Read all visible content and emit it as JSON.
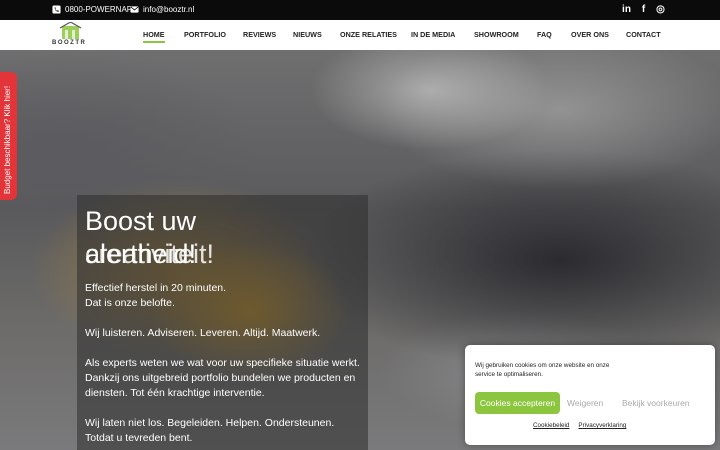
{
  "topbar": {
    "phone": "0800-POWERNAP",
    "email": "info@booztr.nl",
    "social": [
      {
        "icon": "linkedin-icon",
        "glyph": "in"
      },
      {
        "icon": "facebook-icon",
        "glyph": "f"
      },
      {
        "icon": "instagram-icon",
        "glyph": "◎"
      }
    ]
  },
  "logo": {
    "text": "BOOZTR"
  },
  "nav": {
    "items": [
      {
        "label": "HOME",
        "active": true
      },
      {
        "label": "PORTFOLIO"
      },
      {
        "label": "REVIEWS"
      },
      {
        "label": "NIEUWS"
      },
      {
        "label": "ONZE RELATIES"
      },
      {
        "label": "IN DE MEDIA"
      },
      {
        "label": "SHOWROOM"
      },
      {
        "label": "FAQ"
      },
      {
        "label": "OVER ONS"
      },
      {
        "label": "CONTACT"
      }
    ]
  },
  "side_tab": {
    "label": "Budget beschikbaar? Klik hier!"
  },
  "hero": {
    "title_line1": "Boost uw",
    "title_line2_a": "alertheid!",
    "title_line2_b": "creativiteit!",
    "p1_line1": "Effectief herstel in 20 minuten.",
    "p1_line2": "Dat is onze belofte.",
    "p2": "Wij luisteren. Adviseren. Leveren. Altijd. Maatwerk.",
    "p3_line1": "Als experts weten we wat voor uw specifieke situatie werkt.",
    "p3_line2": "Dankzij ons uitgebreid portfolio bundelen we producten en",
    "p3_line3": "diensten. Tot één krachtige interventie.",
    "p4_line1": "Wij laten niet los. Begeleiden. Helpen. Ondersteunen.",
    "p4_line2": "Totdat u tevreden bent."
  },
  "cookie": {
    "message": "Wij gebruiken cookies om onze website en onze service te optimaliseren.",
    "accept_label": "Cookies accepteren",
    "deny_label": "Weigeren",
    "prefs_label": "Bekijk voorkeuren",
    "policy_link": "Cookiebeleid",
    "privacy_link": "Privacyverklaring",
    "accent_color": "#8cc63f"
  }
}
